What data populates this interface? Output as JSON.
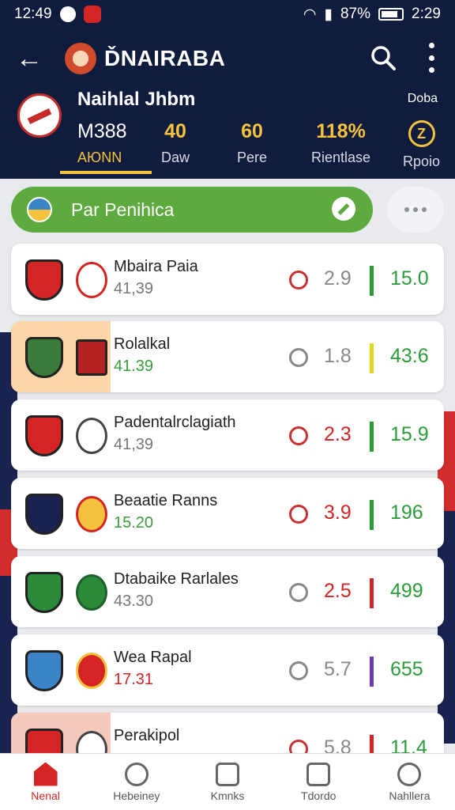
{
  "status_bar": {
    "time": "12:49",
    "battery": "87%",
    "clock": "2:29"
  },
  "app_bar": {
    "title": "ĎNAIRABA",
    "back_icon": "arrow-left-icon",
    "search_icon": "search-icon",
    "more_icon": "more-vert-icon"
  },
  "league": {
    "name": "Naihlal Jhbm",
    "tag": "Doba"
  },
  "stats": [
    {
      "value": "M388",
      "label": "AЮNN"
    },
    {
      "value": "40",
      "label": "Daw"
    },
    {
      "value": "60",
      "label": "Pere"
    },
    {
      "value": "118%",
      "label": "Rientlase"
    },
    {
      "value": "Z",
      "label": "Rpoio"
    }
  ],
  "filter": {
    "label": "Par Penihica"
  },
  "matches": [
    {
      "name": "Mbaira Paia",
      "sub": "41,39",
      "odds": "2.9",
      "score": "15.0"
    },
    {
      "name": "Rolalkal",
      "sub": "41.39",
      "odds": "1.8",
      "score": "43:6"
    },
    {
      "name": "Padentalrclagiath",
      "sub": "41,39",
      "odds": "2.3",
      "score": "15.9"
    },
    {
      "name": "Beaatie Ranns",
      "sub": "15.20",
      "odds": "3.9",
      "score": "196"
    },
    {
      "name": "Dtabaike Rarlales",
      "sub": "43.30",
      "odds": "2.5",
      "score": "499"
    },
    {
      "name": "Wea Rapal",
      "sub": "17.31",
      "odds": "5.7",
      "score": "655"
    },
    {
      "name": "Perakipol",
      "sub": "",
      "odds": "5.8",
      "score": "11.4"
    }
  ],
  "bottom_nav": [
    {
      "label": "Nenal"
    },
    {
      "label": "Hebeiney"
    },
    {
      "label": "Kmnks"
    },
    {
      "label": "Tdordo"
    },
    {
      "label": "Nahllera"
    }
  ],
  "colors": {
    "header": "#0f1c3d",
    "accent": "#f4c23c",
    "green": "#5daa3f",
    "red": "#d42424"
  }
}
